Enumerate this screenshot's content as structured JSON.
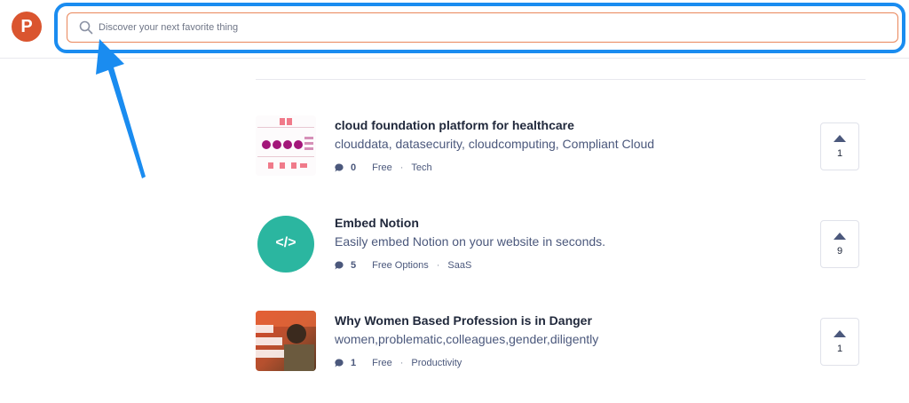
{
  "header": {
    "logo_letter": "P",
    "search": {
      "placeholder": "Discover your next favorite thing",
      "value": ""
    }
  },
  "colors": {
    "brand": "#da552f",
    "highlight": "#1a8cf0",
    "teal": "#2bb6a0"
  },
  "products": [
    {
      "title": "cloud foundation platform for healthcare",
      "tagline": "clouddata, datasecurity, cloudcomputing, Compliant Cloud",
      "comments": "0",
      "pricing": "Free",
      "topic": "Tech",
      "votes": "1"
    },
    {
      "title": "Embed Notion",
      "tagline": "Easily embed Notion on your website in seconds.",
      "comments": "5",
      "pricing": "Free Options",
      "topic": "SaaS",
      "votes": "9",
      "thumb_text": "</>"
    },
    {
      "title": "Why Women Based Profession is in Danger",
      "tagline": "women,problematic,colleagues,gender,diligently",
      "comments": "1",
      "pricing": "Free",
      "topic": "Productivity",
      "votes": "1"
    }
  ]
}
